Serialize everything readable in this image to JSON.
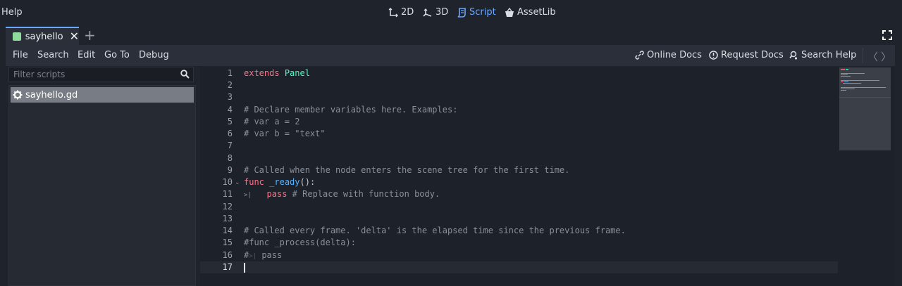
{
  "menu_top": {
    "help": "Help"
  },
  "modes": [
    {
      "label": "2D",
      "icon": "2d-icon"
    },
    {
      "label": "3D",
      "icon": "3d-icon"
    },
    {
      "label": "Script",
      "icon": "script-icon",
      "active": true
    },
    {
      "label": "AssetLib",
      "icon": "assetlib-icon"
    }
  ],
  "tab": {
    "label": "sayhello",
    "close": "✕",
    "add": "+"
  },
  "menubar": {
    "items": [
      "File",
      "Search",
      "Edit",
      "Go To",
      "Debug"
    ],
    "help_links": [
      "Online Docs",
      "Request Docs",
      "Search Help"
    ],
    "nav_back": "〈",
    "nav_forward": "〉"
  },
  "sidebar": {
    "filter_placeholder": "Filter scripts",
    "scripts": [
      "sayhello.gd"
    ]
  },
  "editor": {
    "lines": [
      "1",
      "2",
      "3",
      "4",
      "5",
      "6",
      "7",
      "8",
      "9",
      "10",
      "11",
      "12",
      "13",
      "14",
      "15",
      "16",
      "17"
    ],
    "code": {
      "l1_kw": "extends",
      "l1_ty": "Panel",
      "l4": "# Declare member variables here. Examples:",
      "l5": "# var a = 2",
      "l6": "# var b = \"text\"",
      "l9": "# Called when the node enters the scene tree for the first time.",
      "l10_kw": "func",
      "l10_fn": "_ready",
      "l10_rest": "():",
      "l11_kw": "pass",
      "l11_cm": "# Replace with function body.",
      "l14": "# Called every frame. 'delta' is the elapsed time since the previous frame.",
      "l15": "#func _process(delta):",
      "l16": "#",
      "l16_pass": "pass"
    },
    "current_line": "17"
  },
  "colors": {
    "accent": "#6aa8ff",
    "keyword": "#ff7085",
    "type": "#42ffc2",
    "function": "#57b3ff",
    "comment": "#8b8f97"
  }
}
